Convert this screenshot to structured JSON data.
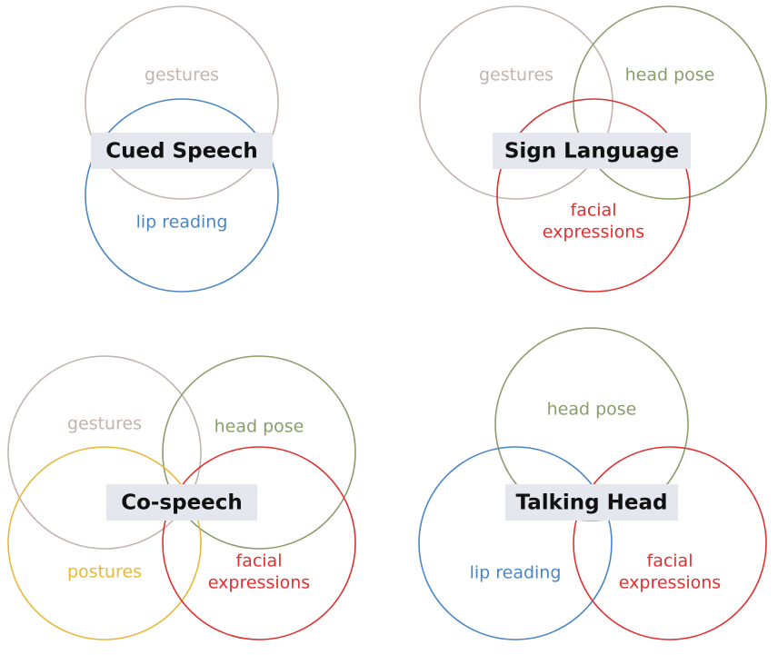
{
  "colors": {
    "gestures": "#c4b2ad",
    "head_pose": "#8a9e6a",
    "lip_reading": "#4a86c5",
    "facial_expressions": "#e03030",
    "postures": "#e8b83a",
    "title_bg": "#e4e7ed"
  },
  "diagrams": [
    {
      "title": "Cued Speech",
      "sets": [
        {
          "key": "gestures",
          "lines": [
            "gestures"
          ],
          "color": "#c4b2ad"
        },
        {
          "key": "lip_reading",
          "lines": [
            "lip reading"
          ],
          "color": "#4a86c5"
        }
      ]
    },
    {
      "title": "Sign Language",
      "sets": [
        {
          "key": "gestures",
          "lines": [
            "gestures"
          ],
          "color": "#c4b2ad"
        },
        {
          "key": "head_pose",
          "lines": [
            "head pose"
          ],
          "color": "#8a9e6a"
        },
        {
          "key": "facial_expressions",
          "lines": [
            "facial",
            "expressions"
          ],
          "color": "#e03030"
        }
      ]
    },
    {
      "title": "Co-speech",
      "sets": [
        {
          "key": "gestures",
          "lines": [
            "gestures"
          ],
          "color": "#c4b2ad"
        },
        {
          "key": "head_pose",
          "lines": [
            "head pose"
          ],
          "color": "#8a9e6a"
        },
        {
          "key": "postures",
          "lines": [
            "postures"
          ],
          "color": "#e8b83a"
        },
        {
          "key": "facial_expressions",
          "lines": [
            "facial",
            "expressions"
          ],
          "color": "#e03030"
        }
      ]
    },
    {
      "title": "Talking Head",
      "sets": [
        {
          "key": "head_pose",
          "lines": [
            "head pose"
          ],
          "color": "#8a9e6a"
        },
        {
          "key": "lip_reading",
          "lines": [
            "lip reading"
          ],
          "color": "#4a86c5"
        },
        {
          "key": "facial_expressions",
          "lines": [
            "facial",
            "expressions"
          ],
          "color": "#e03030"
        }
      ]
    }
  ]
}
